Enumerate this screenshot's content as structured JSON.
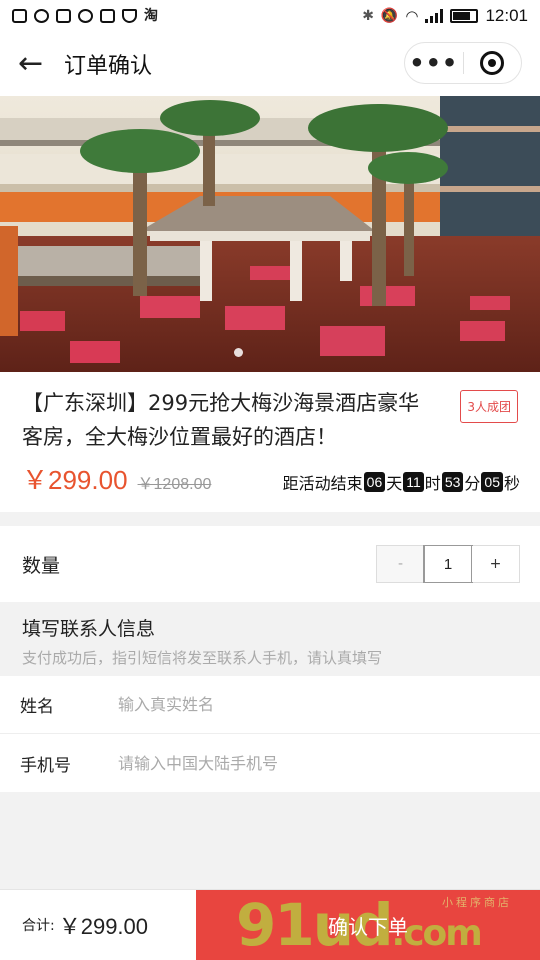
{
  "status_bar": {
    "time": "12:01",
    "left_icons": [
      "message-icon",
      "chat-icon",
      "sim-icon",
      "browser-icon",
      "image-icon",
      "shield-icon",
      "taobao-icon"
    ],
    "left_glyph": "淘"
  },
  "nav": {
    "title": "订单确认",
    "more_label": "•••"
  },
  "product": {
    "title": "【广东深圳】299元抢大梅沙海景酒店豪华客房，全大梅沙位置最好的酒店！",
    "badge": "3人成团",
    "price": "￥299.00",
    "original_price": "￥1208.00",
    "countdown": {
      "prefix": "距活动结束",
      "days": "06",
      "days_unit": "天",
      "hours": "11",
      "hours_unit": "时",
      "minutes": "53",
      "minutes_unit": "分",
      "seconds": "05",
      "seconds_unit": "秒"
    }
  },
  "quantity": {
    "label": "数量",
    "minus": "-",
    "value": "1",
    "plus": "+"
  },
  "contact": {
    "title": "填写联系人信息",
    "subtitle": "支付成功后，指引短信将发至联系人手机，请认真填写",
    "name_label": "姓名",
    "name_placeholder": "输入真实姓名",
    "phone_label": "手机号",
    "phone_placeholder": "请输入中国大陆手机号"
  },
  "footer": {
    "total_label": "合计:",
    "total_value": "￥299.00",
    "confirm_label": "确认下单"
  },
  "watermark": {
    "main": "91ud",
    "suffix": ".com",
    "small": "小程序商店"
  },
  "colors": {
    "accent": "#e8453f",
    "price": "#e8542f",
    "badge": "#e34b4b"
  }
}
